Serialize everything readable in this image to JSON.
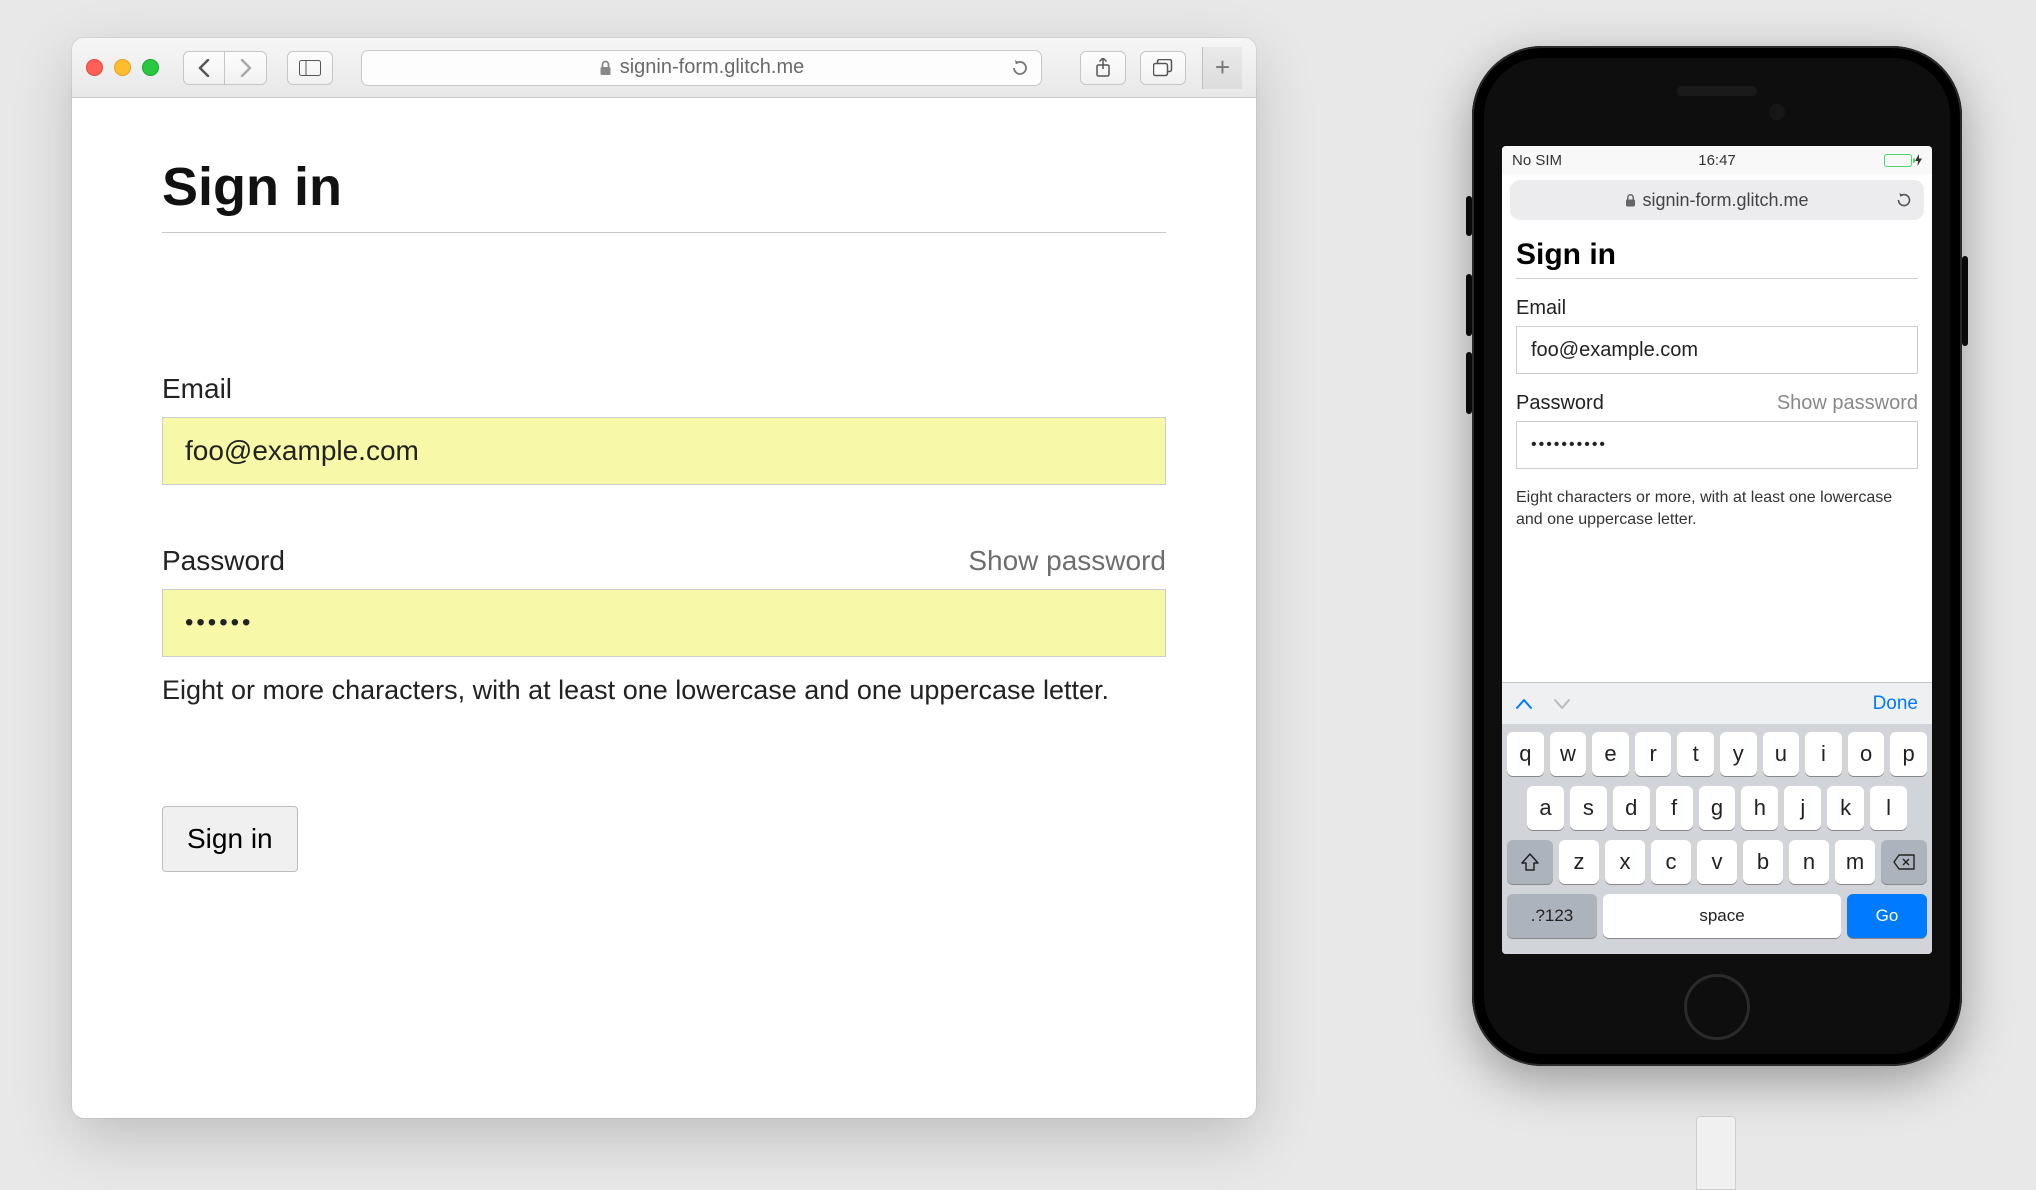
{
  "desktop": {
    "url": "signin-form.glitch.me",
    "page": {
      "title": "Sign in",
      "email": {
        "label": "Email",
        "value": "foo@example.com"
      },
      "password": {
        "label": "Password",
        "show_password": "Show password",
        "value_masked": "••••••",
        "hint": "Eight or more characters, with at least one lowercase and one uppercase letter."
      },
      "submit": "Sign in"
    },
    "new_tab_glyph": "+"
  },
  "mobile": {
    "status": {
      "carrier": "No SIM",
      "time": "16:47"
    },
    "url": "signin-form.glitch.me",
    "page": {
      "title": "Sign in",
      "email": {
        "label": "Email",
        "value": "foo@example.com"
      },
      "password": {
        "label": "Password",
        "show_password": "Show password",
        "value_masked": "••••••••••",
        "hint": "Eight characters or more, with at least one lowercase and one uppercase letter."
      }
    },
    "keyboard": {
      "done": "Done",
      "row1": [
        "q",
        "w",
        "e",
        "r",
        "t",
        "y",
        "u",
        "i",
        "o",
        "p"
      ],
      "row2": [
        "a",
        "s",
        "d",
        "f",
        "g",
        "h",
        "j",
        "k",
        "l"
      ],
      "row3": [
        "z",
        "x",
        "c",
        "v",
        "b",
        "n",
        "m"
      ],
      "mode": ".?123",
      "space": "space",
      "go": "Go"
    }
  }
}
